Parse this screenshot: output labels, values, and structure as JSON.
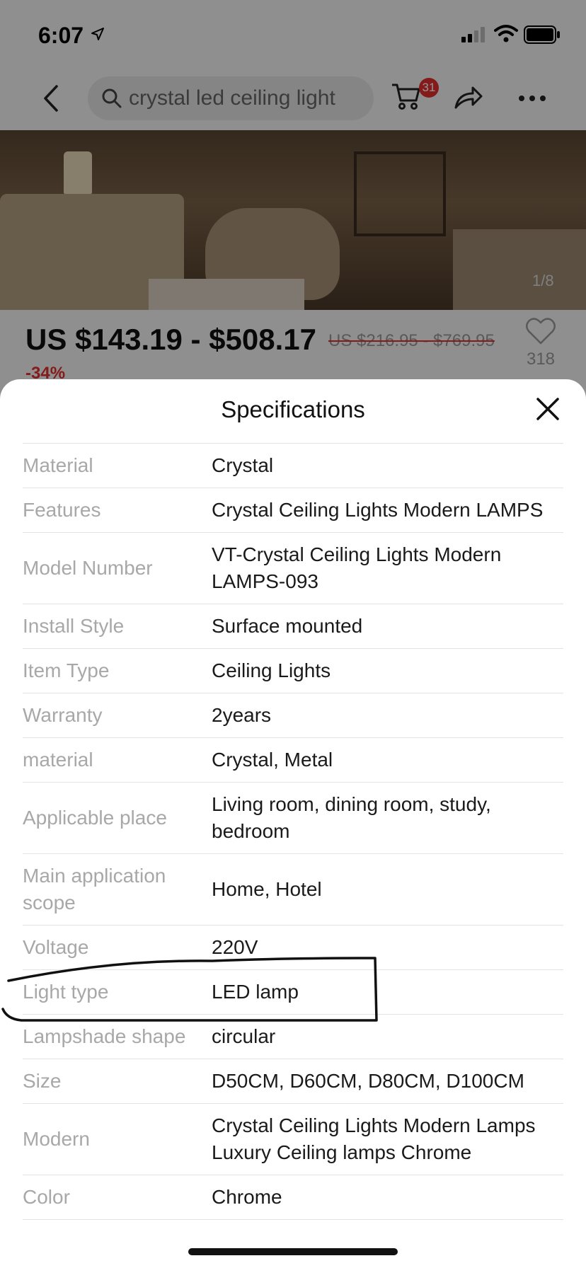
{
  "status_bar": {
    "time": "6:07"
  },
  "nav": {
    "search_text": "crystal led ceiling light",
    "cart_count": "31"
  },
  "product": {
    "image_counter": "1/8",
    "price": "US $143.19 - $508.17",
    "original_price": "US $216.95 - $769.95",
    "discount": "-34%",
    "wishlist_count": "318"
  },
  "specifications": {
    "title": "Specifications",
    "rows": [
      {
        "label": "Material",
        "value": "Crystal"
      },
      {
        "label": "Features",
        "value": "Crystal Ceiling Lights Modern LAMPS"
      },
      {
        "label": "Model Number",
        "value": "VT-Crystal Ceiling Lights Modern LAMPS-093"
      },
      {
        "label": "Install Style",
        "value": "Surface mounted"
      },
      {
        "label": "Item Type",
        "value": "Ceiling Lights"
      },
      {
        "label": "Warranty",
        "value": "2years"
      },
      {
        "label": "material",
        "value": "Crystal, Metal"
      },
      {
        "label": "Applicable place",
        "value": "Living room, dining room, study, bedroom"
      },
      {
        "label": "Main application scope",
        "value": "Home, Hotel"
      },
      {
        "label": "Voltage",
        "value": "220V"
      },
      {
        "label": "Light type",
        "value": "LED lamp"
      },
      {
        "label": "Lampshade shape",
        "value": "circular"
      },
      {
        "label": "Size",
        "value": "D50CM, D60CM, D80CM, D100CM"
      },
      {
        "label": "Modern",
        "value": "Crystal Ceiling Lights Modern Lamps Luxury Ceiling lamps Chrome"
      },
      {
        "label": "Color",
        "value": "Chrome"
      }
    ]
  },
  "colors": {
    "accent_red": "#e62e2e",
    "label_gray": "#a8a8a8",
    "overlay": "rgba(0,0,0,0.42)"
  }
}
